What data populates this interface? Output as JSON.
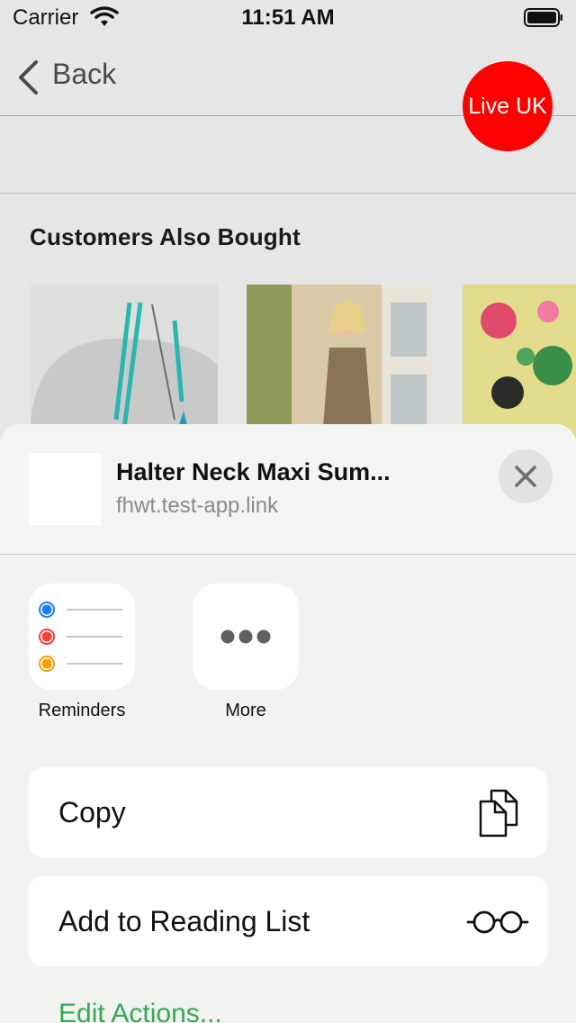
{
  "status_bar": {
    "carrier": "Carrier",
    "time": "11:51 AM"
  },
  "nav": {
    "back_label": "Back",
    "badge": "Live UK"
  },
  "section": {
    "title": "Customers Also Bought"
  },
  "share_sheet": {
    "link_title": "Halter Neck Maxi Sum...",
    "link_url": "fhwt.test-app.link",
    "apps": [
      {
        "label": "Reminders",
        "icon": "reminders-icon"
      },
      {
        "label": "More",
        "icon": "more-icon"
      }
    ],
    "actions": [
      {
        "label": "Copy",
        "icon": "copy-icon"
      },
      {
        "label": "Add to Reading List",
        "icon": "glasses-icon"
      }
    ],
    "edit_actions": "Edit Actions..."
  },
  "colors": {
    "badge": "#ff0000",
    "edit_actions": "#34a853",
    "reminder_dots": [
      "#1e7ef2",
      "#f2413a",
      "#f5a00a"
    ]
  }
}
